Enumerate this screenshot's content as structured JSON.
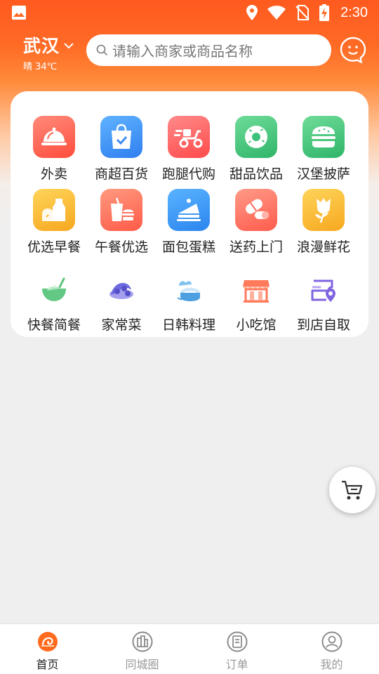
{
  "status_bar": {
    "time": "2:30"
  },
  "header": {
    "city": "武汉",
    "weather": "晴 34℃",
    "search_placeholder": "请输入商家或商品名称"
  },
  "categories": [
    {
      "label": "外卖",
      "icon": "food-cloche-icon",
      "color": "#ff5c4d"
    },
    {
      "label": "商超百货",
      "icon": "shopping-bag-icon",
      "color": "#3b8cf3"
    },
    {
      "label": "跑腿代购",
      "icon": "scooter-icon",
      "color": "#ff5c5c"
    },
    {
      "label": "甜品饮品",
      "icon": "donut-icon",
      "color": "#3cc27a"
    },
    {
      "label": "汉堡披萨",
      "icon": "burger-icon",
      "color": "#40c47f"
    },
    {
      "label": "优选早餐",
      "icon": "bread-milk-icon",
      "color": "#f9b731"
    },
    {
      "label": "午餐优选",
      "icon": "fastfood-icon",
      "color": "#ff6a55"
    },
    {
      "label": "面包蛋糕",
      "icon": "cake-icon",
      "color": "#3496f0"
    },
    {
      "label": "送药上门",
      "icon": "pill-icon",
      "color": "#ff6a5e"
    },
    {
      "label": "浪漫鲜花",
      "icon": "rose-icon",
      "color": "#f8b530"
    },
    {
      "label": "快餐简餐",
      "icon": "bowl-icon",
      "color": "#5cc37c"
    },
    {
      "label": "家常菜",
      "icon": "dish-icon",
      "color": "#6f6ae0"
    },
    {
      "label": "日韩料理",
      "icon": "sushi-icon",
      "color": "#4c9fe0"
    },
    {
      "label": "小吃馆",
      "icon": "storefront-icon",
      "color": "#ff7a5a"
    },
    {
      "label": "到店自取",
      "icon": "pickup-location-icon",
      "color": "#8064e0"
    }
  ],
  "tabbar": {
    "items": [
      {
        "label": "首页",
        "icon": "home-icon",
        "active": true
      },
      {
        "label": "同城圈",
        "icon": "city-circle-icon",
        "active": false
      },
      {
        "label": "订单",
        "icon": "order-icon",
        "active": false
      },
      {
        "label": "我的",
        "icon": "profile-icon",
        "active": false
      }
    ]
  },
  "colors": {
    "accent": "#ff5a1f"
  }
}
